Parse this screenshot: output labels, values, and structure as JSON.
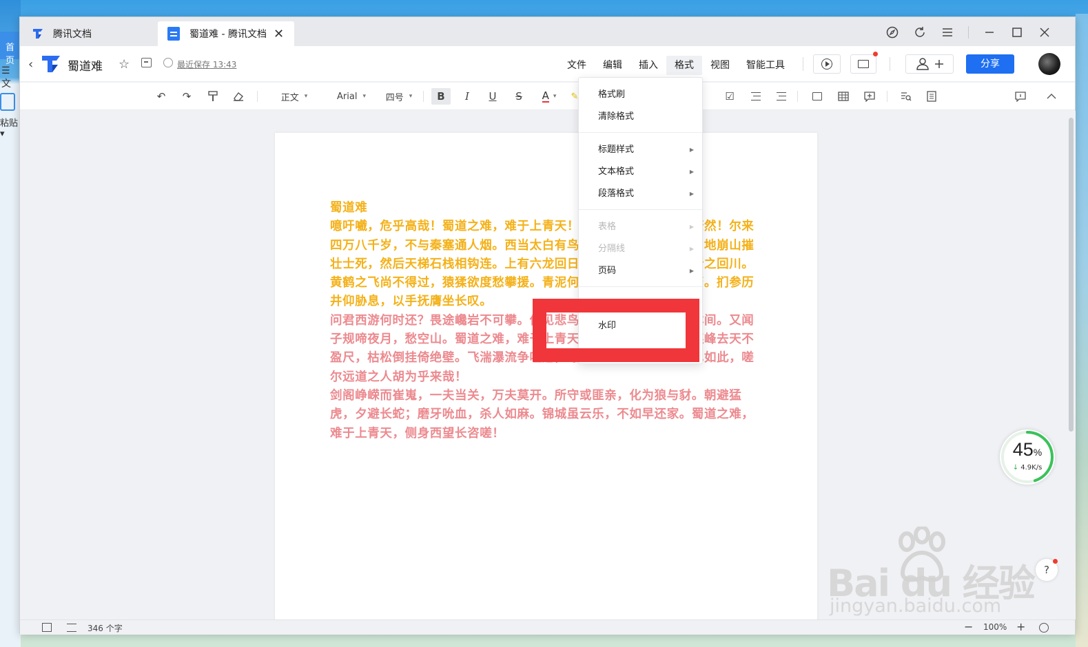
{
  "desktop": {
    "home_tab": "首页",
    "menu": "☰ 文",
    "paste": "粘贴▾"
  },
  "tabs": [
    {
      "label": "腾讯文档",
      "active": false
    },
    {
      "label": "蜀道难 - 腾讯文档",
      "active": true
    }
  ],
  "doc_header": {
    "title": "蜀道难",
    "save_status": "最近保存 13:43",
    "menu": [
      "文件",
      "编辑",
      "插入",
      "格式",
      "视图",
      "智能工具"
    ],
    "active_menu": "格式",
    "share_label": "分享",
    "accent_color": "#1e6ff1"
  },
  "toolbar": {
    "style_select": "正文",
    "font_select": "Arial",
    "size_select": "四号"
  },
  "format_menu": {
    "items": [
      {
        "label": "格式刷",
        "submenu": false,
        "disabled": false
      },
      {
        "label": "清除格式",
        "submenu": false,
        "disabled": false
      },
      {
        "label": "标题样式",
        "submenu": true,
        "disabled": false
      },
      {
        "label": "文本格式",
        "submenu": true,
        "disabled": false
      },
      {
        "label": "段落格式",
        "submenu": true,
        "disabled": false
      },
      {
        "label": "表格",
        "submenu": true,
        "disabled": true
      },
      {
        "label": "分隔线",
        "submenu": true,
        "disabled": true
      },
      {
        "label": "页码",
        "submenu": true,
        "disabled": false
      },
      {
        "label": "水印",
        "submenu": false,
        "disabled": false,
        "highlighted": true
      }
    ]
  },
  "document": {
    "heading": "蜀道难",
    "paragraphs": [
      {
        "color": "#f4b119",
        "text": "噫吁嚱，危乎高哉！蜀道之难，难于上青天！蚕丛及鱼凫，开国何茫然！尔来四万八千岁，不与秦塞通人烟。西当太白有鸟道，可以横绝峨眉巅。地崩山摧壮士死，然后天梯石栈相钩连。上有六龙回日之高标，下有冲波逆折之回川。黄鹤之飞尚不得过，猿猱欲度愁攀援。青泥何盘盘，百步九折萦岩峦。扪参历井仰胁息，以手抚膺坐长叹。"
      },
      {
        "color": "#ec8a8f",
        "text": "问君西游何时还？畏途巉岩不可攀。但见悲鸟号古木，雄飞雌从绕林间。又闻子规啼夜月，愁空山。蜀道之难，难于上青天，使人听此凋朱颜！连峰去天不盈尺，枯松倒挂倚绝壁。飞湍瀑流争喧豗，砯崖转石万壑雷。其险也如此，嗟尔远道之人胡为乎来哉！"
      },
      {
        "color": "#ec8a8f",
        "text": "剑阁峥嵘而崔嵬，一夫当关，万夫莫开。所守或匪亲，化为狼与豺。朝避猛虎，夕避长蛇；磨牙吮血，杀人如麻。锦城虽云乐，不如早还家。蜀道之难，难于上青天，侧身西望长咨嗟！"
      }
    ]
  },
  "status_bar": {
    "word_count": "346 个字",
    "zoom": "100%"
  },
  "speed_widget": {
    "percent": "45",
    "percent_sign": "%",
    "rate": "4.9K/s",
    "level": 0.45
  },
  "help_label": "?",
  "watermark": {
    "main": "Bai du 经验",
    "sub": "jingyan.baidu.com"
  }
}
